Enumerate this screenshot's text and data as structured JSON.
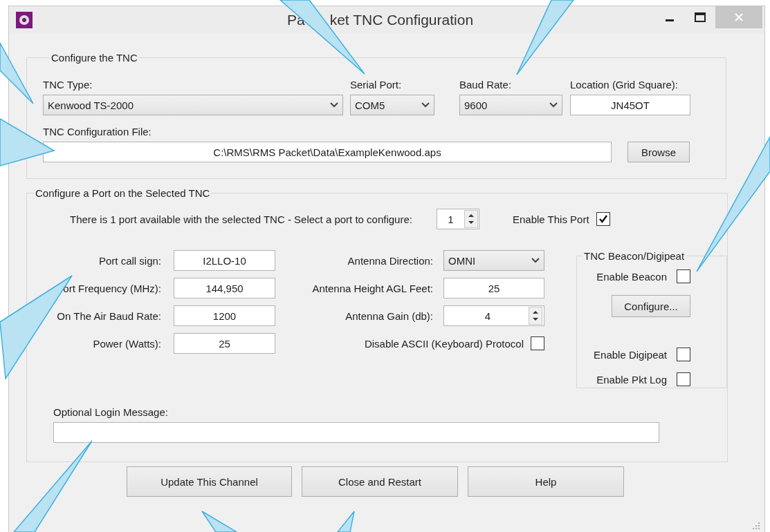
{
  "window": {
    "title_parts": [
      "Pa",
      "ket TNC Configuration"
    ]
  },
  "tnc_group": {
    "legend": "Configure the TNC",
    "fields": [
      {
        "kind": "combo",
        "label": "TNC Type:",
        "value": "Kenwood TS-2000"
      },
      {
        "kind": "combo",
        "label": "Serial Port:",
        "value": "COM5"
      },
      {
        "kind": "combo",
        "label": "Baud Rate:",
        "value": "9600"
      },
      {
        "kind": "text",
        "label": "Location (Grid Square):",
        "value": "JN45OT"
      }
    ],
    "config_file": {
      "label": "TNC Configuration File:",
      "value": "C:\\RMS\\RMS Packet\\Data\\ExampleKenwood.aps"
    },
    "browse_button": "Browse"
  },
  "port_group": {
    "legend": "Configure a Port on the Selected TNC",
    "port_prompt": "There is 1 port available with the selected TNC - Select a port to configure:",
    "port_spinner": "1",
    "enable_port": {
      "label": "Enable This Port",
      "checked": true
    },
    "left_fields": [
      {
        "label": "Port call sign:",
        "value": "I2LLO-10"
      },
      {
        "label": "ort Frequency (MHz):",
        "value": "144,950"
      },
      {
        "label": "On The Air Baud Rate:",
        "value": "1200"
      },
      {
        "label": "Power (Watts):",
        "value": "25"
      }
    ],
    "right_fields": [
      {
        "kind": "combo",
        "label": "Antenna Direction:",
        "value": "OMNI"
      },
      {
        "kind": "text",
        "label": "Antenna Height AGL Feet:",
        "value": "25"
      },
      {
        "kind": "spin",
        "label": "Antenna Gain (db):",
        "value": "4"
      },
      {
        "kind": "check",
        "label": "Disable ASCII (Keyboard) Protocol",
        "checked": false
      }
    ],
    "beacon_group": {
      "legend": "TNC Beacon/Digipeat",
      "enable_beacon": {
        "label": "Enable Beacon",
        "checked": false
      },
      "configure_button": "Configure...",
      "options": [
        {
          "label": "Enable Digipeat",
          "checked": false
        },
        {
          "label": "Enable Pkt Log",
          "checked": false
        }
      ]
    },
    "login": {
      "label": "Optional Login Message:"
    }
  },
  "buttons": [
    "Update This Channel",
    "Close and Restart",
    "Help"
  ]
}
